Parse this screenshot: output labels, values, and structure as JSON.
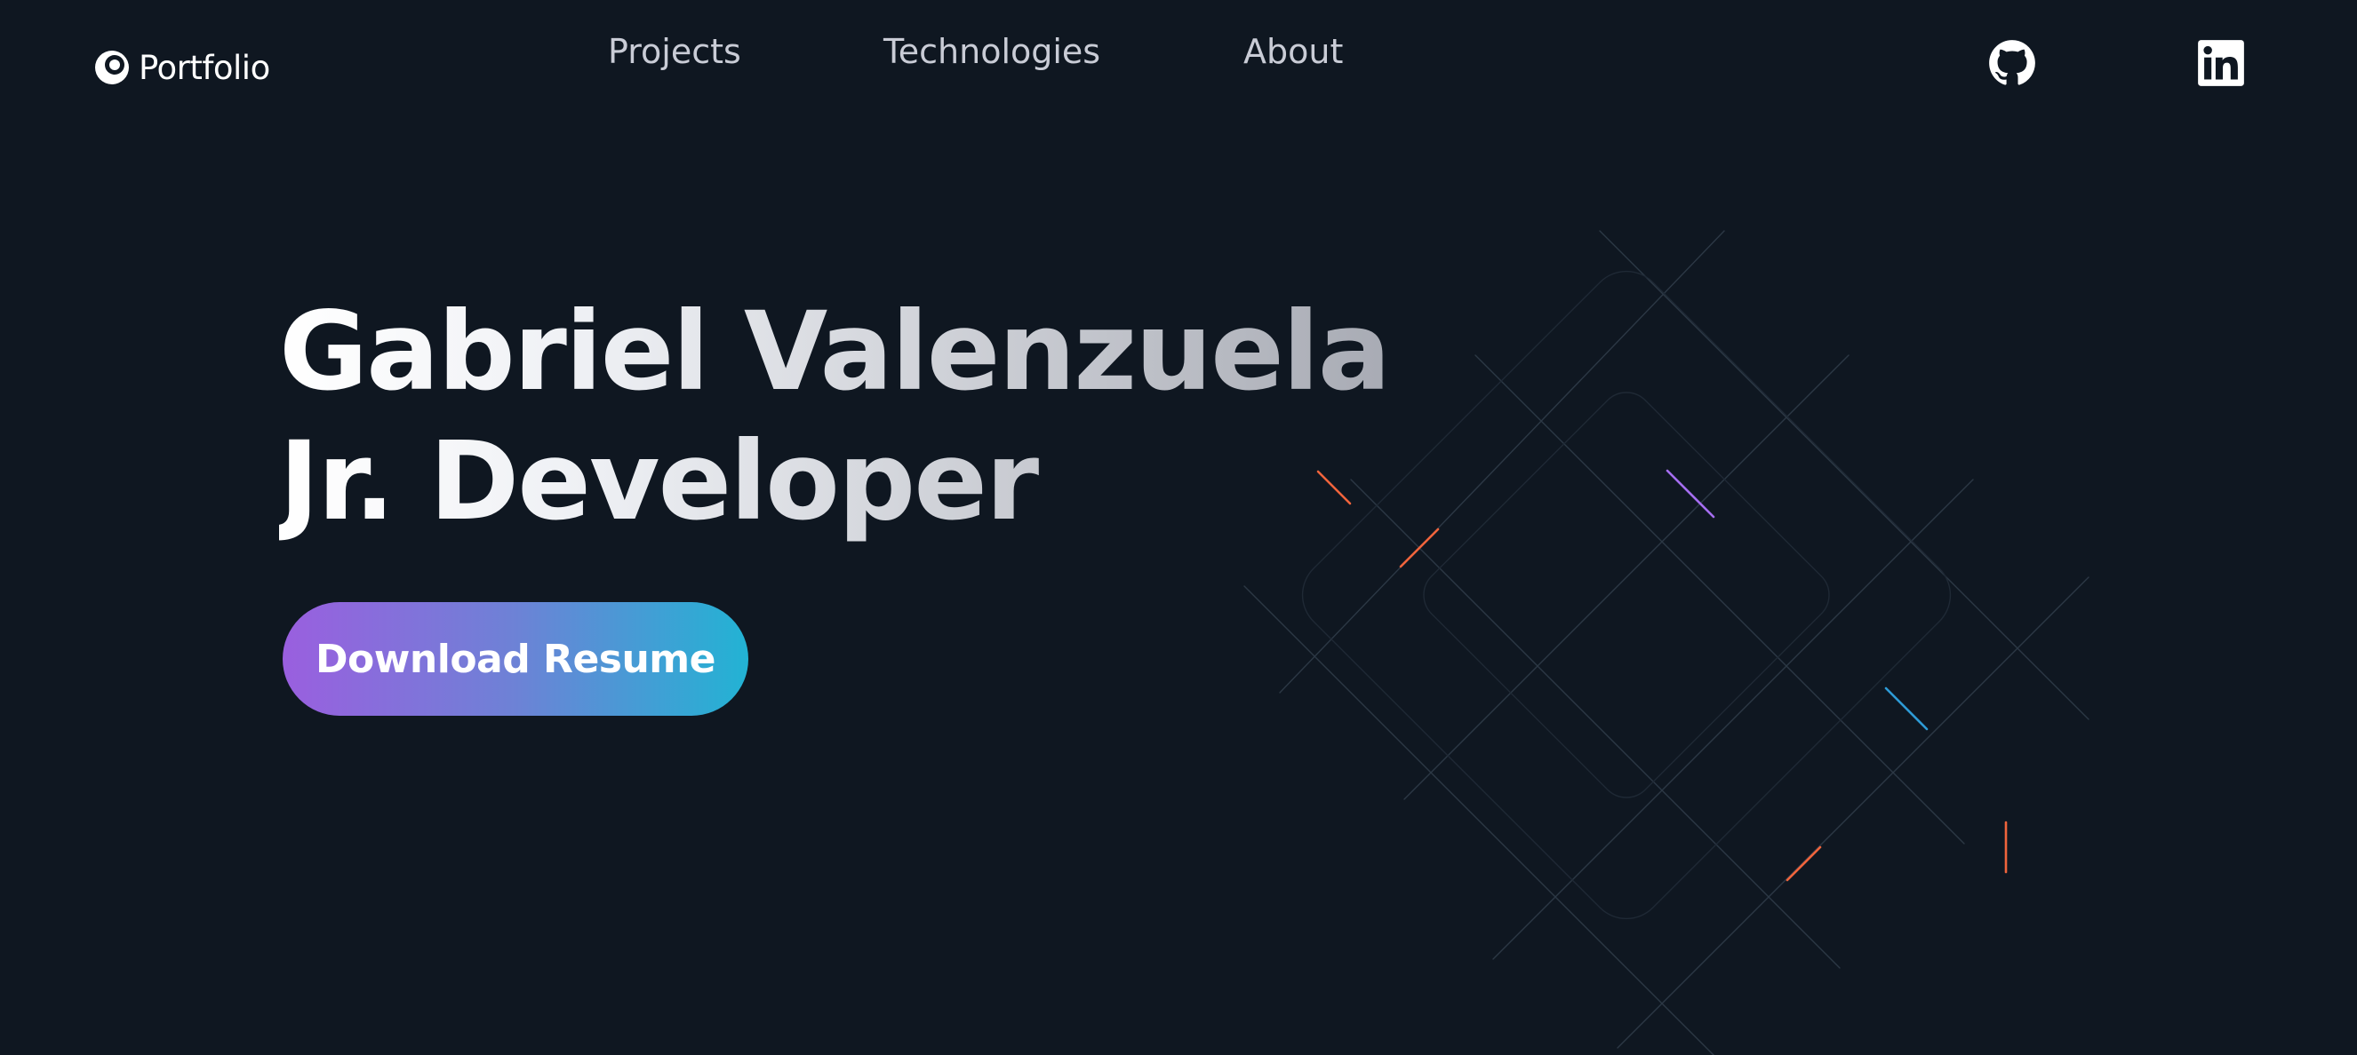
{
  "nav": {
    "logo_text": "Portfolio",
    "logo_icon": "portfolio-logo-icon",
    "links": [
      "Projects",
      "Technologies",
      "About"
    ],
    "social": [
      {
        "name": "github",
        "icon": "github-icon"
      },
      {
        "name": "linkedin",
        "icon": "linkedin-icon"
      }
    ]
  },
  "hero": {
    "title_line1": "Gabriel Valenzuela",
    "title_line2": "Jr. Developer",
    "cta_label": "Download Resume"
  },
  "colors": {
    "background": "#0f1721",
    "nav_text": "#c9ccd6",
    "cta_gradient_start": "#9a5fdf",
    "cta_gradient_end": "#22b3d4",
    "accent_orange": "#f0643c",
    "accent_purple": "#a56ef0",
    "accent_blue": "#2e9bd6"
  }
}
